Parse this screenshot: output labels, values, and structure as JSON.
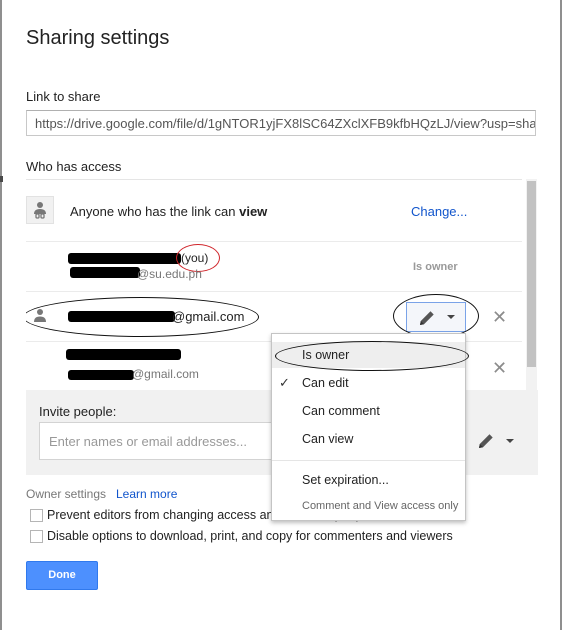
{
  "dialog": {
    "title": "Sharing settings"
  },
  "link": {
    "label": "Link to share",
    "url": "https://drive.google.com/file/d/1gNTOR1yjFX8lSC64ZXclXFB9kfbHQzLJ/view?usp=sha"
  },
  "access": {
    "label": "Who has access",
    "anyone": {
      "prefix": "Anyone who has the link can ",
      "level": "view",
      "change_label": "Change..."
    },
    "people": [
      {
        "name_suffix": "(you)",
        "email_suffix": "@su.edu.ph",
        "role": "Is owner"
      },
      {
        "email_suffix": "@gmail.com"
      },
      {
        "email_suffix": "@gmail.com"
      }
    ]
  },
  "permission_menu": {
    "items": [
      "Is owner",
      "Can edit",
      "Can comment",
      "Can view"
    ],
    "checked_item": "Can edit",
    "expiration_label": "Set expiration...",
    "expiration_note": "Comment and View access only"
  },
  "invite": {
    "label": "Invite people:",
    "placeholder": "Enter names or email addresses..."
  },
  "owner_settings": {
    "label": "Owner settings",
    "learn_more": "Learn more",
    "option_prevent": "Prevent editors from changing access and add new people",
    "option_disable": "Disable options to download, print, and copy for commenters and viewers"
  },
  "done_label": "Done",
  "colors": {
    "link_blue": "#1155cc",
    "done_blue": "#4d90fe",
    "annotation_red": "#d0252b"
  }
}
